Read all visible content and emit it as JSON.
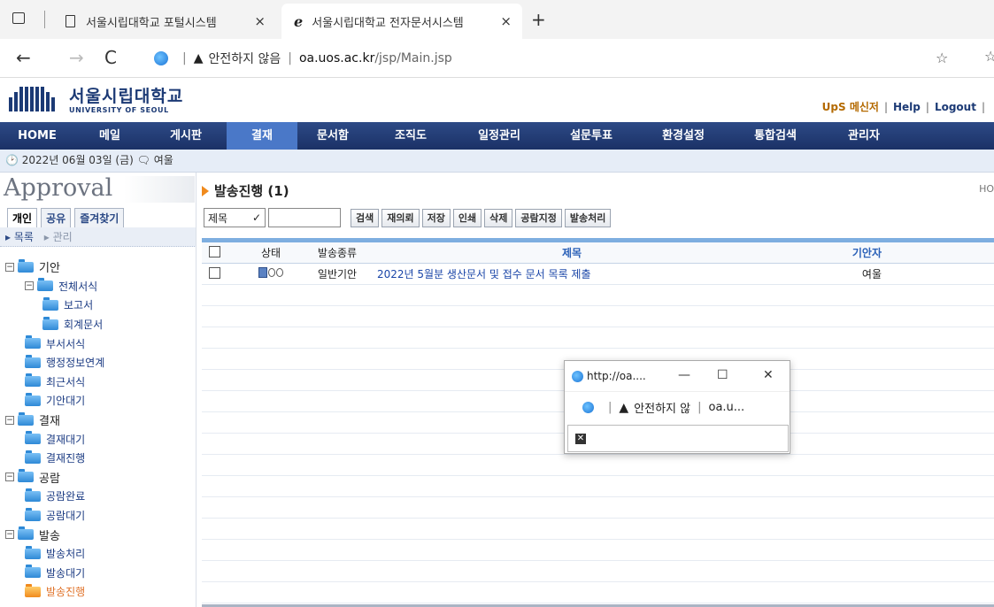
{
  "browser": {
    "tabs": [
      {
        "label": "서울시립대학교 포털시스템"
      },
      {
        "label": "서울시립대학교 전자문서시스템"
      }
    ],
    "tab_close": "×",
    "new_tab": "+",
    "nav": {
      "back": "←",
      "forward": "→",
      "refresh": "C"
    },
    "url": {
      "security_text": "안전하지 않음",
      "host": "oa.uos.ac.kr",
      "path": "/jsp/Main.jsp"
    },
    "fav_icon": "☆"
  },
  "site": {
    "logo_kr": "서울시립대학교",
    "logo_en": "UNIVERSITY OF SEOUL",
    "util_links": {
      "messenger": "메신저",
      "help": "Help",
      "logout": "Logout"
    },
    "menu": [
      "HOME",
      "메일",
      "게시판",
      "결재",
      "문서함",
      "조직도",
      "일정관리",
      "설문투표",
      "환경설정",
      "통합검색",
      "관리자"
    ],
    "active_menu": "결재",
    "date_text": "2022년 06월 03일 (금)",
    "user_text": "여울"
  },
  "sidebar": {
    "title": "Approval",
    "tabs": [
      "개인",
      "공유",
      "즐겨찾기"
    ],
    "sub_tabs": [
      "목록",
      "관리"
    ],
    "tree": [
      {
        "label": "기안",
        "level": 0,
        "toggle": "−"
      },
      {
        "label": "전체서식",
        "level": 1,
        "toggle": "−"
      },
      {
        "label": "보고서",
        "level": 2
      },
      {
        "label": "회계문서",
        "level": 2
      },
      {
        "label": "부서서식",
        "level": 1
      },
      {
        "label": "행정정보연계",
        "level": 1
      },
      {
        "label": "최근서식",
        "level": 1
      },
      {
        "label": "기안대기",
        "level": 1
      },
      {
        "label": "결재",
        "level": 0,
        "toggle": "−"
      },
      {
        "label": "결재대기",
        "level": 1
      },
      {
        "label": "결재진행",
        "level": 1
      },
      {
        "label": "공람",
        "level": 0,
        "toggle": "−"
      },
      {
        "label": "공람완료",
        "level": 1
      },
      {
        "label": "공람대기",
        "level": 1
      },
      {
        "label": "발송",
        "level": 0,
        "toggle": "−"
      },
      {
        "label": "발송처리",
        "level": 1
      },
      {
        "label": "발송대기",
        "level": 1
      },
      {
        "label": "발송진행",
        "level": 1,
        "open": true
      }
    ]
  },
  "content": {
    "title": "발송진행 (1)",
    "home_link": "HO",
    "search_field": "제목",
    "search_value": "",
    "buttons": [
      "검색",
      "재의뢰",
      "저장",
      "인쇄",
      "삭제",
      "공람지정",
      "발송처리"
    ],
    "columns": {
      "status": "상태",
      "type": "발송종류",
      "title": "제목",
      "author": "기안자"
    },
    "rows": [
      {
        "type": "일반기안",
        "title": "2022년 5월분 생산문서 및 접수 문서 목록 제출",
        "author": "여울"
      }
    ]
  },
  "popup": {
    "title": "http://oa....",
    "security_text": "안전하지 않",
    "host": "oa.u..."
  }
}
